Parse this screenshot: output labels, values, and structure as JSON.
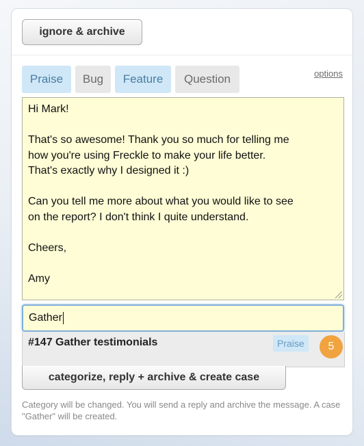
{
  "toolbar": {
    "ignore_label": "ignore & archive"
  },
  "tabs": [
    {
      "label": "Praise",
      "active": true
    },
    {
      "label": "Bug",
      "active": false
    },
    {
      "label": "Feature",
      "active": true
    },
    {
      "label": "Question",
      "active": false
    }
  ],
  "options_label": "options",
  "reply": {
    "lines": [
      "Hi Mark!",
      "",
      "That's so awesome! Thank you so much for telling me",
      "how you're using Freckle to make your life better.",
      "That's exactly why I designed it :)",
      "",
      "Can you tell me more about what you would like to see",
      "on the report? I don't think I quite understand.",
      "",
      "Cheers,",
      "",
      "Amy"
    ]
  },
  "case_input": {
    "value": "Gather"
  },
  "suggestion": {
    "title": "#147 Gather testimonials",
    "badge": "Praise",
    "count": "5"
  },
  "actions": {
    "categorize_label": "categorize, reply + archive & create case"
  },
  "help_text": "Category will be changed. You will send a reply and archive the message. A case \"Gather\" will be created.",
  "colors": {
    "active_tab_bg": "#cfe7f7",
    "inactive_tab_bg": "#e8e8e8",
    "reply_bg": "#fefdd6",
    "count_badge": "#f0a33e"
  }
}
